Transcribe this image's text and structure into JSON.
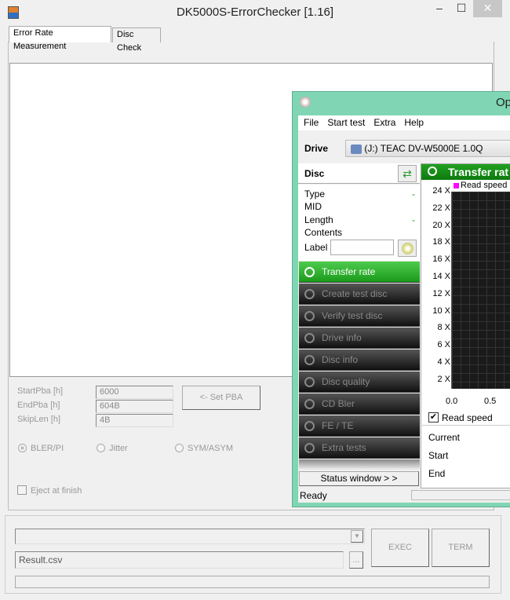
{
  "window": {
    "title": "DK5000S-ErrorChecker [1.16]",
    "minimize": "–",
    "maximize": "☐",
    "close": "✕"
  },
  "tabs": [
    {
      "label": "Error Rate Measurement",
      "active": true
    },
    {
      "label": "Disc Check",
      "active": false
    }
  ],
  "pba": {
    "start_label": "StartPba [h]",
    "start_value": "6000",
    "end_label": "EndPba [h]",
    "end_value": "604B",
    "skip_label": "SkipLen [h]",
    "skip_value": "4B",
    "set_button": "<-  Set PBA"
  },
  "modes": [
    {
      "label": "BLER/PI",
      "selected": true
    },
    {
      "label": "Jitter",
      "selected": false
    },
    {
      "label": "SYM/ASYM",
      "selected": false
    }
  ],
  "eject": {
    "label": "Eject at finish",
    "checked": false
  },
  "bottom": {
    "combo_value": "",
    "file_value": "Result.csv",
    "browse": "...",
    "exec": "EXEC",
    "term": "TERM",
    "progress": 0
  },
  "overlay": {
    "title": "Op",
    "menu": [
      "File",
      "Start test",
      "Extra",
      "Help"
    ],
    "drive_label": "Drive",
    "drive_value": "(J:)   TEAC DV-W5000E 1.0Q",
    "disc_label": "Disc",
    "disc_fields": [
      {
        "label": "Type",
        "value": "-"
      },
      {
        "label": "MID",
        "value": ""
      },
      {
        "label": "Length",
        "value": "-"
      },
      {
        "label": "Contents",
        "value": ""
      }
    ],
    "label_field": "Label",
    "label_value": "",
    "sidebar": [
      {
        "label": "Transfer rate",
        "active": true
      },
      {
        "label": "Create test disc"
      },
      {
        "label": "Verify test disc"
      },
      {
        "label": "Drive info"
      },
      {
        "label": "Disc info"
      },
      {
        "label": "Disc quality"
      },
      {
        "label": "CD Bler"
      },
      {
        "label": "FE / TE"
      },
      {
        "label": "Extra tests"
      }
    ],
    "status_window": "Status window > >",
    "status": "Ready",
    "chart_title": "Transfer rat",
    "read_speed_checkbox": "Read speed",
    "stats": [
      "Current",
      "Start",
      "End"
    ],
    "colors": {
      "frame": "#80d6b4",
      "accent": "#1a9a1a"
    }
  },
  "chart_data": {
    "type": "line",
    "legend": [
      "Read speed"
    ],
    "series": [
      {
        "name": "Read speed",
        "values": []
      }
    ],
    "y_ticks": [
      "24 X",
      "22 X",
      "20 X",
      "18 X",
      "16 X",
      "14 X",
      "12 X",
      "10 X",
      "8 X",
      "6 X",
      "4 X",
      "2 X"
    ],
    "x_ticks": [
      "0.0",
      "0.5"
    ],
    "ylim": [
      0,
      24
    ],
    "grid": true
  }
}
